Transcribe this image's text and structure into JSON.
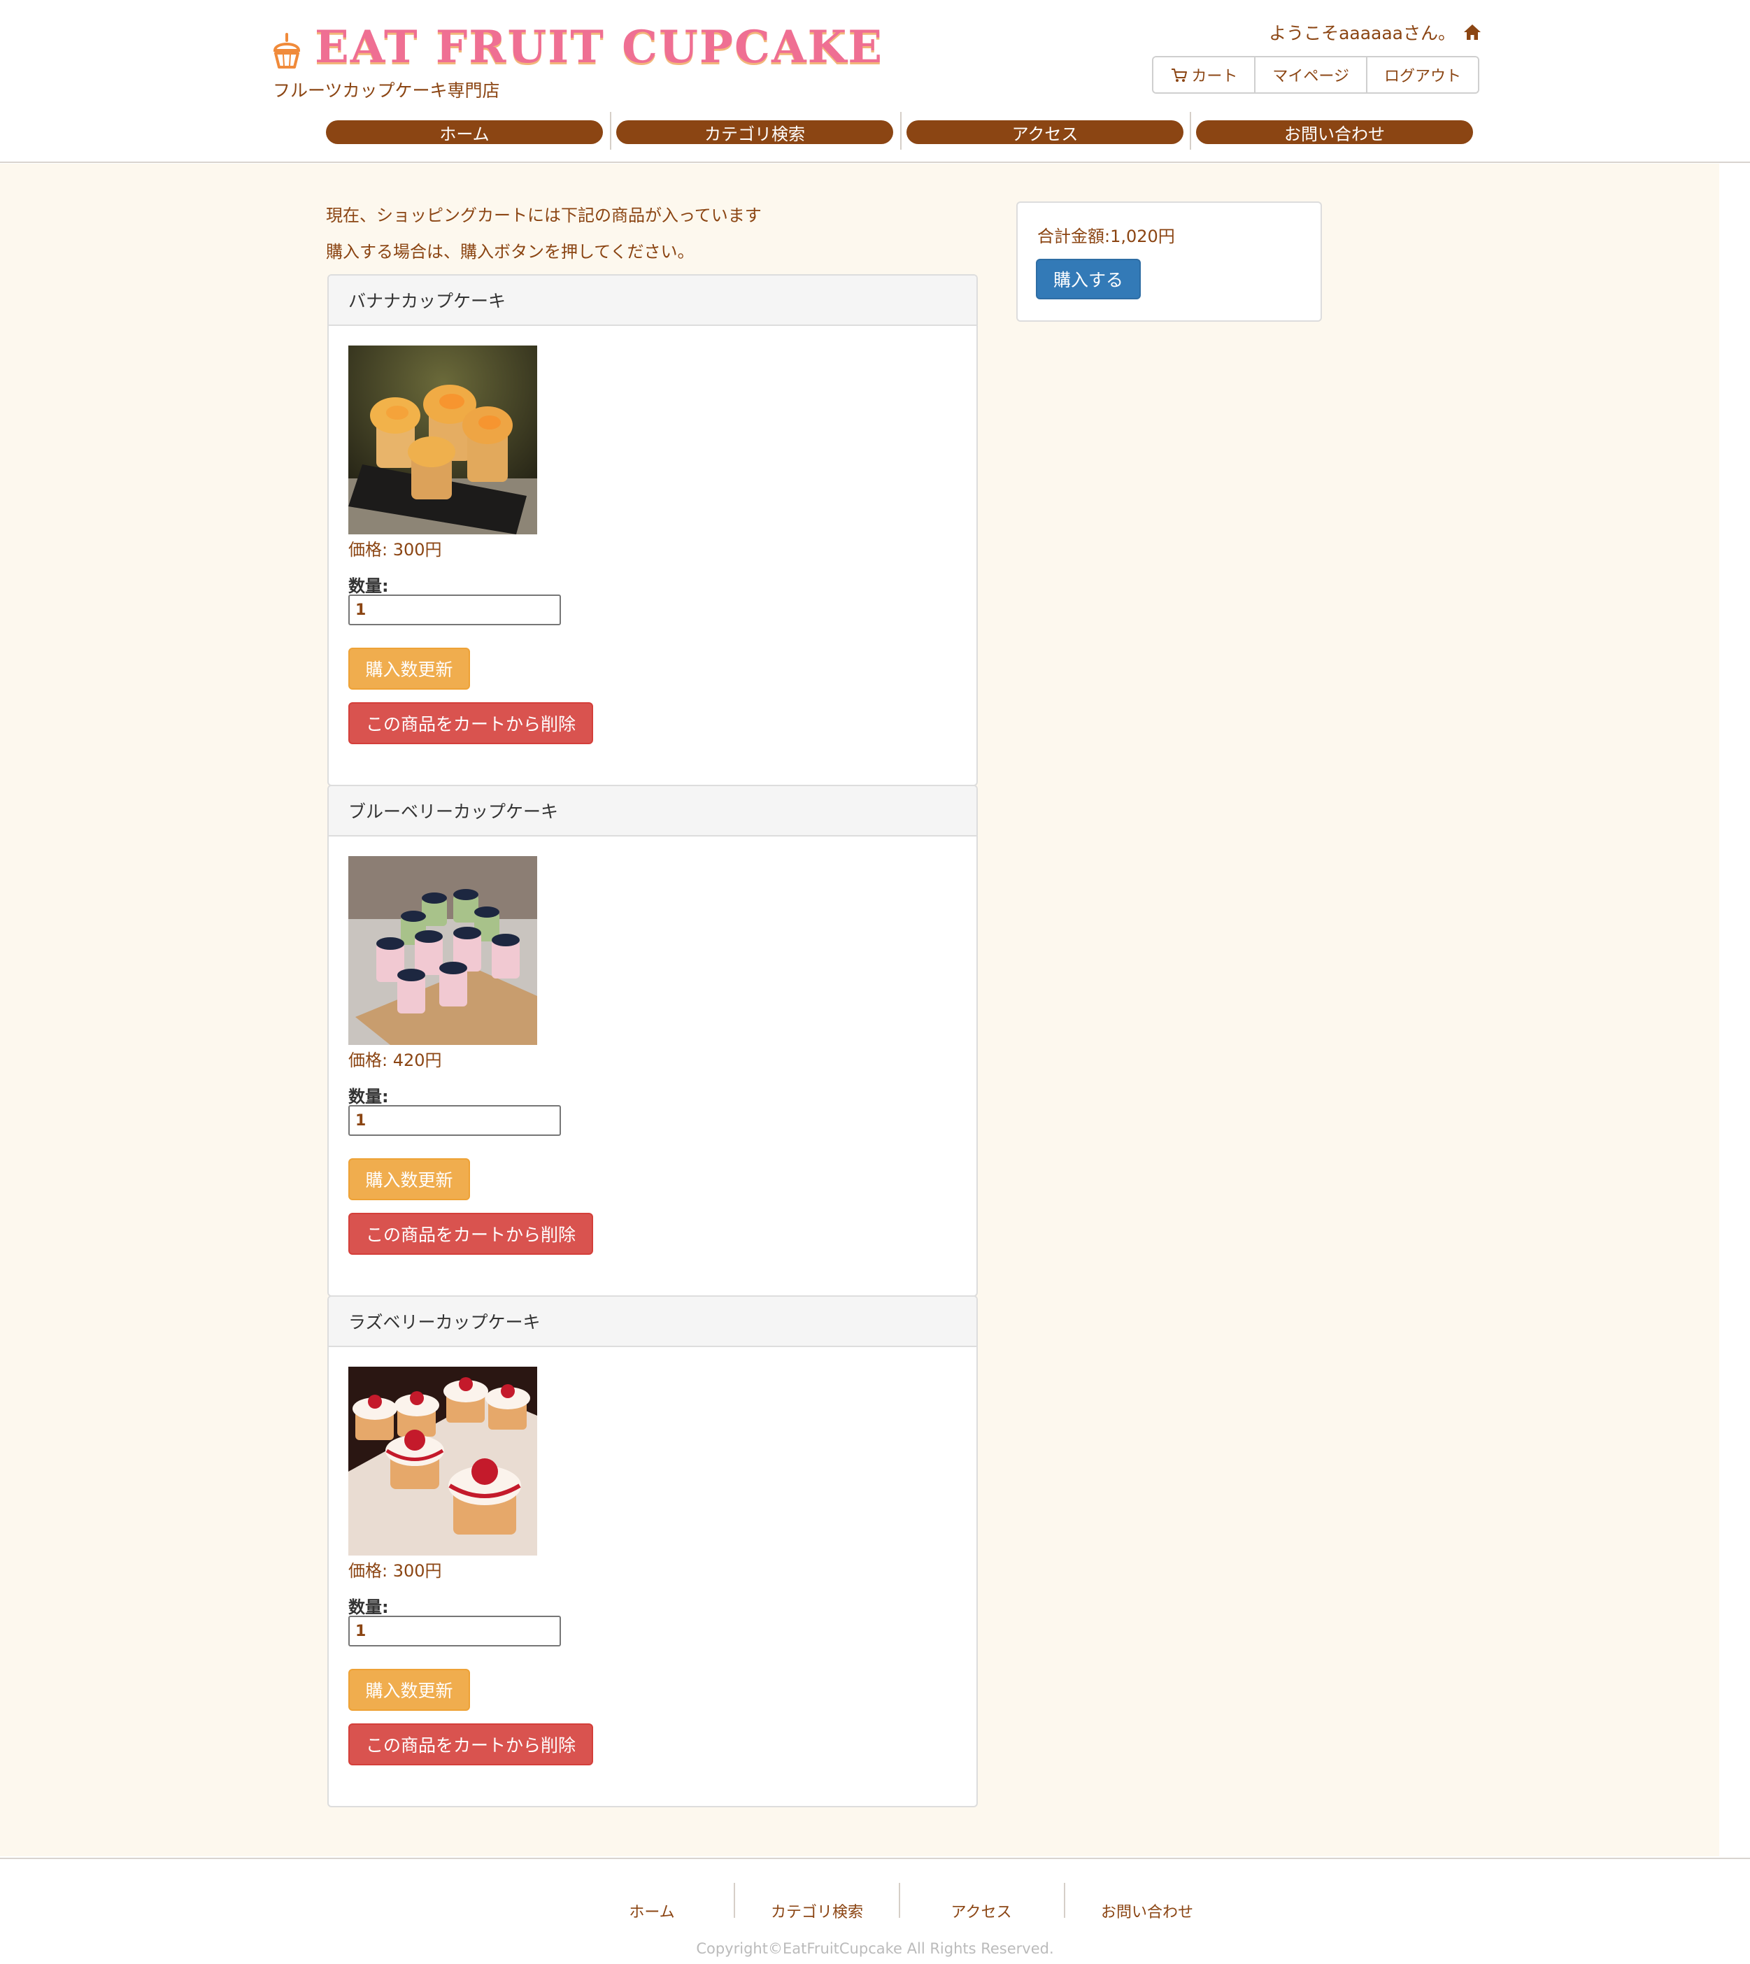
{
  "header": {
    "logo_text": "EAT FRUIT CUPCAKE",
    "tagline": "フルーツカップケーキ専門店",
    "welcome": "ようこそaaaaaaさん。",
    "user_buttons": {
      "cart": "カート",
      "mypage": "マイページ",
      "logout": "ログアウト"
    }
  },
  "nav": {
    "home": "ホーム",
    "category": "カテゴリ検索",
    "access": "アクセス",
    "contact": "お問い合わせ"
  },
  "cart": {
    "intro_line1": "現在、ショッピングカートには下記の商品が入っています",
    "intro_line2": "購入する場合は、購入ボタンを押してください。",
    "items": [
      {
        "name": "バナナカップケーキ",
        "price": "価格: 300円",
        "qty_label": "数量:",
        "qty_value": "1",
        "update_label": "購入数更新",
        "delete_label": "この商品をカートから削除"
      },
      {
        "name": "ブルーベリーカップケーキ",
        "price": "価格: 420円",
        "qty_label": "数量:",
        "qty_value": "1",
        "update_label": "購入数更新",
        "delete_label": "この商品をカートから削除"
      },
      {
        "name": "ラズベリーカップケーキ",
        "price": "価格: 300円",
        "qty_label": "数量:",
        "qty_value": "1",
        "update_label": "購入数更新",
        "delete_label": "この商品をカートから削除"
      }
    ]
  },
  "summary": {
    "total": "合計金額:1,020円",
    "buy_label": "購入する"
  },
  "footer": {
    "home": "ホーム",
    "category": "カテゴリ検索",
    "access": "アクセス",
    "contact": "お問い合わせ",
    "copyright": "Copyright©EatFruitCupcake All Rights Reserved."
  },
  "colors": {
    "brand_brown": "#8b4513",
    "logo_pink": "#ef6f93",
    "page_bg": "#fdf8ee",
    "warning": "#f0ad4e",
    "danger": "#d9534f",
    "primary": "#337ab7"
  },
  "icons": {
    "logo": "cupcake-icon",
    "home": "home-icon",
    "cart": "cart-icon"
  }
}
